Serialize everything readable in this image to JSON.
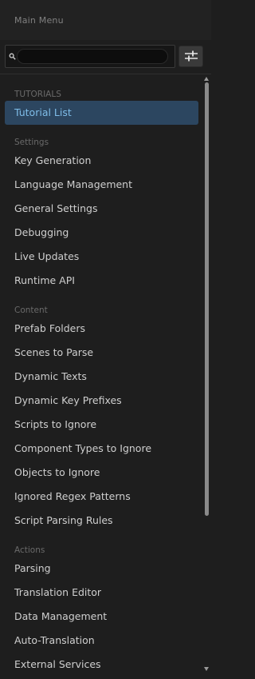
{
  "window": {
    "title": "Main Menu"
  },
  "search": {
    "value": "",
    "placeholder": ""
  },
  "icons": {
    "search": "search-icon",
    "filter": "sliders-icon"
  },
  "colors": {
    "background": "#1e1e1e",
    "selected_bg": "#2c4660",
    "selected_text": "#7fbde8"
  },
  "sections": {
    "tutorials": {
      "header": "TUTORIALS",
      "items": [
        "Tutorial List"
      ],
      "selected": "Tutorial List"
    },
    "settings": {
      "header": "Settings",
      "items": [
        "Key Generation",
        "Language Management",
        "General Settings",
        "Debugging",
        "Live Updates",
        "Runtime API"
      ]
    },
    "content": {
      "header": "Content",
      "items": [
        "Prefab Folders",
        "Scenes to Parse",
        "Dynamic Texts",
        "Dynamic Key Prefixes",
        "Scripts to Ignore",
        "Component Types to Ignore",
        "Objects to Ignore",
        "Ignored Regex Patterns",
        "Script Parsing Rules"
      ]
    },
    "actions": {
      "header": "Actions",
      "items": [
        "Parsing",
        "Translation Editor",
        "Data Management",
        "Auto-Translation",
        "External Services"
      ]
    }
  }
}
